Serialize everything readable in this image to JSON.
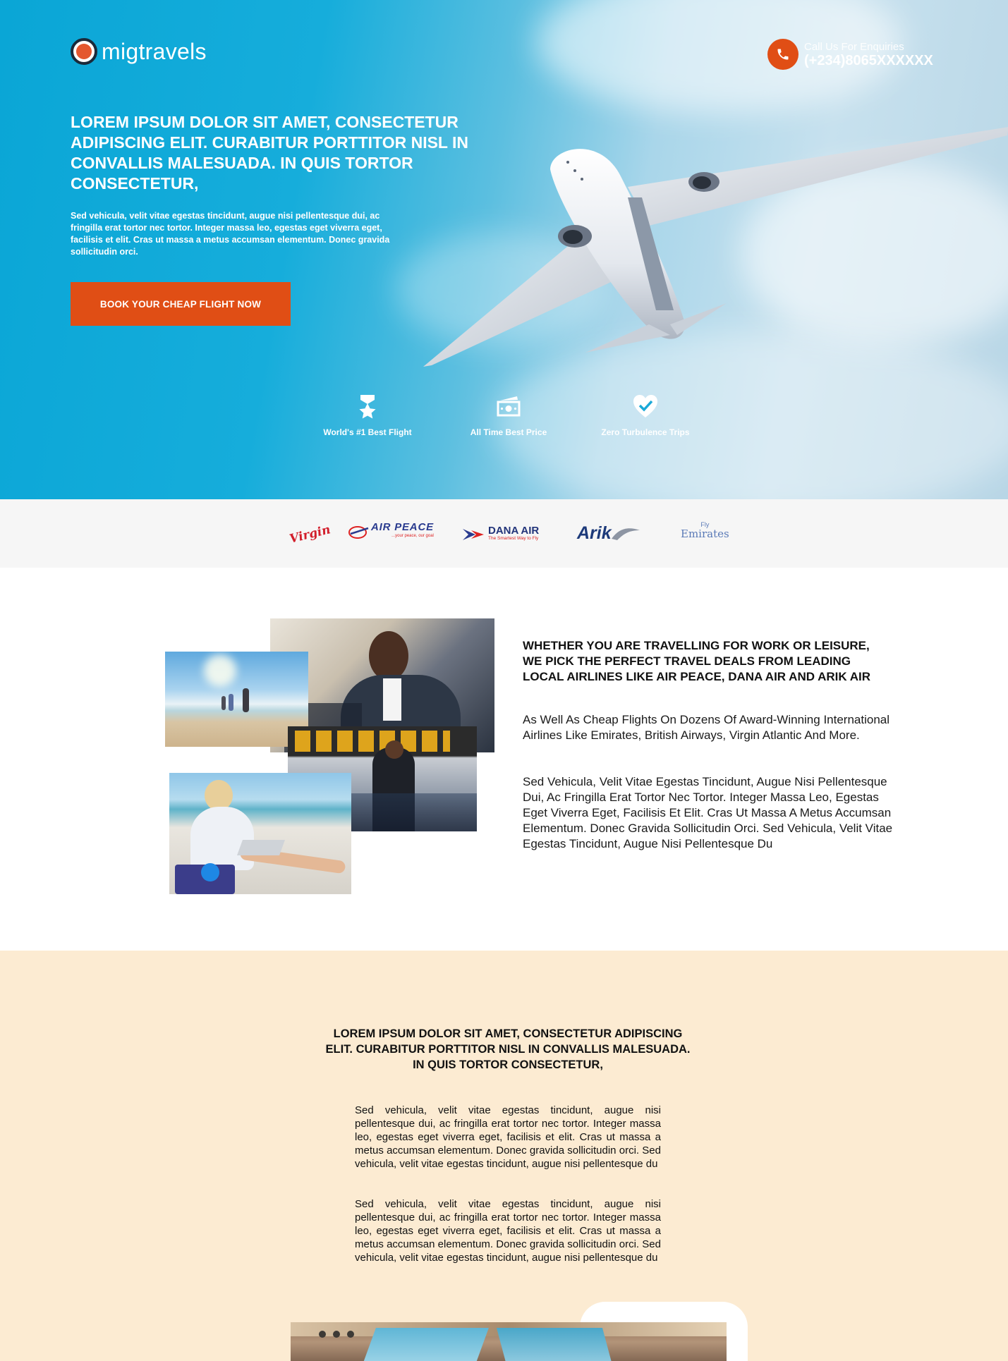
{
  "brand": {
    "name": "migtravels"
  },
  "contact": {
    "label": "Call Us For Enquiries",
    "number": "(+234)8065XXXXXX"
  },
  "hero": {
    "title": "LOREM IPSUM DOLOR SIT AMET, CONSECTETUR ADIPISCING ELIT. CURABITUR PORTTITOR NISL IN CONVALLIS MALESUADA. IN QUIS TORTOR CONSECTETUR,",
    "subtitle": "Sed vehicula, velit vitae egestas tincidunt, augue nisi pellentesque dui, ac fringilla erat tortor nec tortor. Integer massa leo, egestas eget viverra eget, facilisis et elit. Cras ut massa a metus accumsan elementum. Donec gravida sollicitudin orci.",
    "cta_label": "BOOK YOUR CHEAP FLIGHT NOW"
  },
  "features": [
    {
      "label": "World's #1 Best Flight",
      "icon": "medal-star-icon"
    },
    {
      "label": "All Time Best Price",
      "icon": "money-icon"
    },
    {
      "label": "Zero Turbulence Trips",
      "icon": "heart-check-icon"
    }
  ],
  "partners": [
    {
      "name": "Virgin"
    },
    {
      "name": "AIR PEACE",
      "tagline": "...your peace, our goal"
    },
    {
      "name": "DANA AIR",
      "tagline": "The Smartest Way to Fly"
    },
    {
      "name": "Arik"
    },
    {
      "name": "Emirates",
      "prefix": "Fly"
    }
  ],
  "intro": {
    "title": "WHETHER YOU ARE TRAVELLING FOR WORK OR LEISURE, WE PICK THE PERFECT TRAVEL DEALS FROM LEADING LOCAL AIRLINES LIKE AIR PEACE, DANA AIR AND ARIK AIR",
    "paragraph1": "As Well As Cheap Flights On Dozens Of Award-Winning International Airlines Like Emirates, British Airways, Virgin Atlantic And More.",
    "paragraph2": "Sed Vehicula, Velit Vitae Egestas Tincidunt, Augue Nisi Pellentesque Dui, Ac Fringilla Erat Tortor Nec Tortor. Integer Massa Leo, Egestas Eget Viverra Eget, Facilisis Et Elit. Cras Ut Massa A Metus Accumsan Elementum. Donec Gravida Sollicitudin Orci. Sed Vehicula, Velit Vitae Egestas Tincidunt, Augue Nisi Pellentesque Du"
  },
  "section2": {
    "title": "LOREM IPSUM DOLOR SIT AMET, CONSECTETUR ADIPISCING ELIT. CURABITUR PORTTITOR NISL IN CONVALLIS MALESUADA. IN QUIS TORTOR CONSECTETUR,",
    "paragraph1": "Sed vehicula, velit vitae egestas tincidunt, augue nisi pellentesque dui, ac fringilla erat tortor nec tortor. Integer massa leo, egestas eget viverra eget, facilisis et elit. Cras ut massa a metus accumsan elementum. Donec gravida sollicitudin orci. Sed vehicula, velit vitae egestas tincidunt, augue nisi pellentesque du",
    "paragraph2": "Sed vehicula, velit vitae egestas tincidunt, augue nisi pellentesque dui, ac fringilla erat tortor nec tortor. Integer massa leo, egestas eget viverra eget, facilisis et elit. Cras ut massa a metus accumsan elementum. Donec gravida sollicitudin orci. Sed vehicula, velit vitae egestas tincidunt, augue nisi pellentesque du"
  },
  "colors": {
    "accent": "#e04e15",
    "hero_blue": "#0aa6d6",
    "beige": "#fcebd2",
    "partner_bar": "#f6f6f6"
  }
}
